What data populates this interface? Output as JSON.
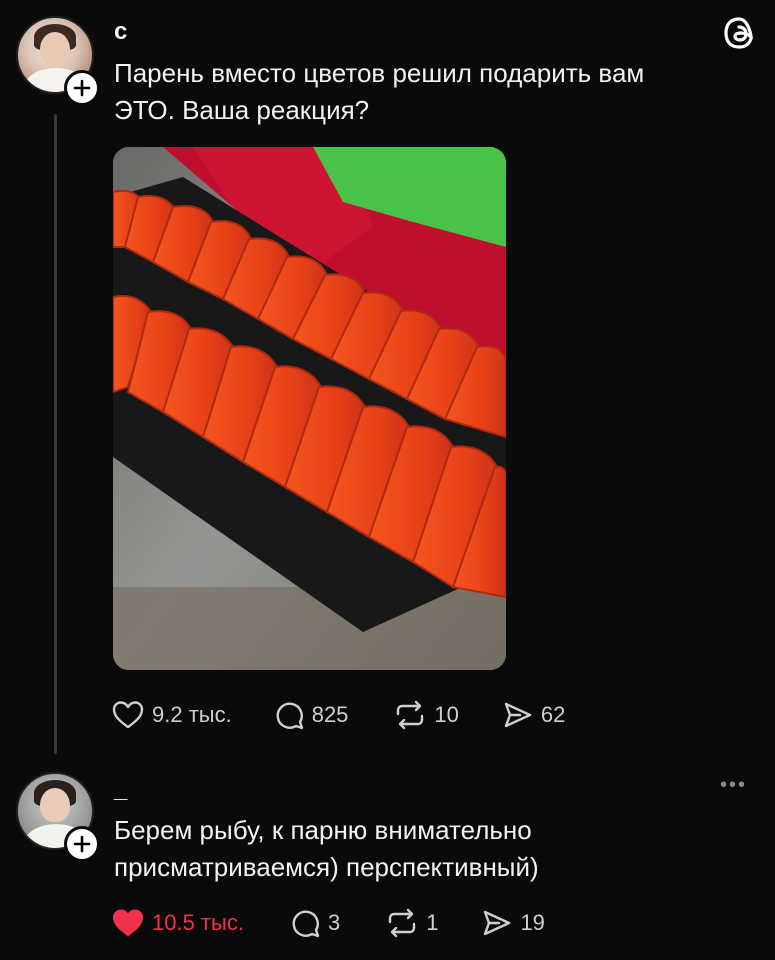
{
  "app": {
    "logo_icon": "threads-logo-icon"
  },
  "post": {
    "username": "с",
    "text_line1": "Парень вместо цветов решил подарить вам",
    "text_line2": "ЭТО. Ваша реакция?",
    "image_alt": "salmon fillet slices",
    "stats": {
      "likes": "9.2 тыс.",
      "comments": "825",
      "reposts": "10",
      "shares": "62"
    }
  },
  "reply": {
    "username": "_",
    "text_line1": "Берем рыбу, к парню внимательно",
    "text_line2": "присматриваемся) перспективный)",
    "more_label": "•••",
    "stats": {
      "likes": "10.5 тыс.",
      "comments": "3",
      "reposts": "1",
      "shares": "19"
    }
  },
  "colors": {
    "background": "#0a0a0a",
    "like_active": "#f0324b",
    "text": "#f2f2f2"
  }
}
